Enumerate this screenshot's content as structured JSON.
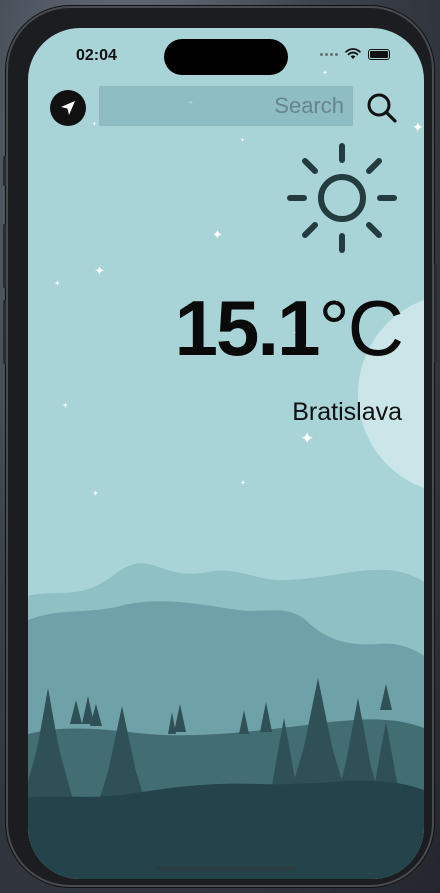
{
  "status": {
    "time": "02:04"
  },
  "search": {
    "placeholder": "Search",
    "value": ""
  },
  "weather": {
    "temperature": "15.1",
    "unit": "°C",
    "city": "Bratislava",
    "condition_icon": "sun-icon"
  },
  "colors": {
    "sky": "#a8d4d8",
    "mountains_far": "#8fc0c4",
    "mountains_mid": "#6fa2a8",
    "forest": "#426d73",
    "ground": "#24434a",
    "text": "#0a0a0a"
  }
}
